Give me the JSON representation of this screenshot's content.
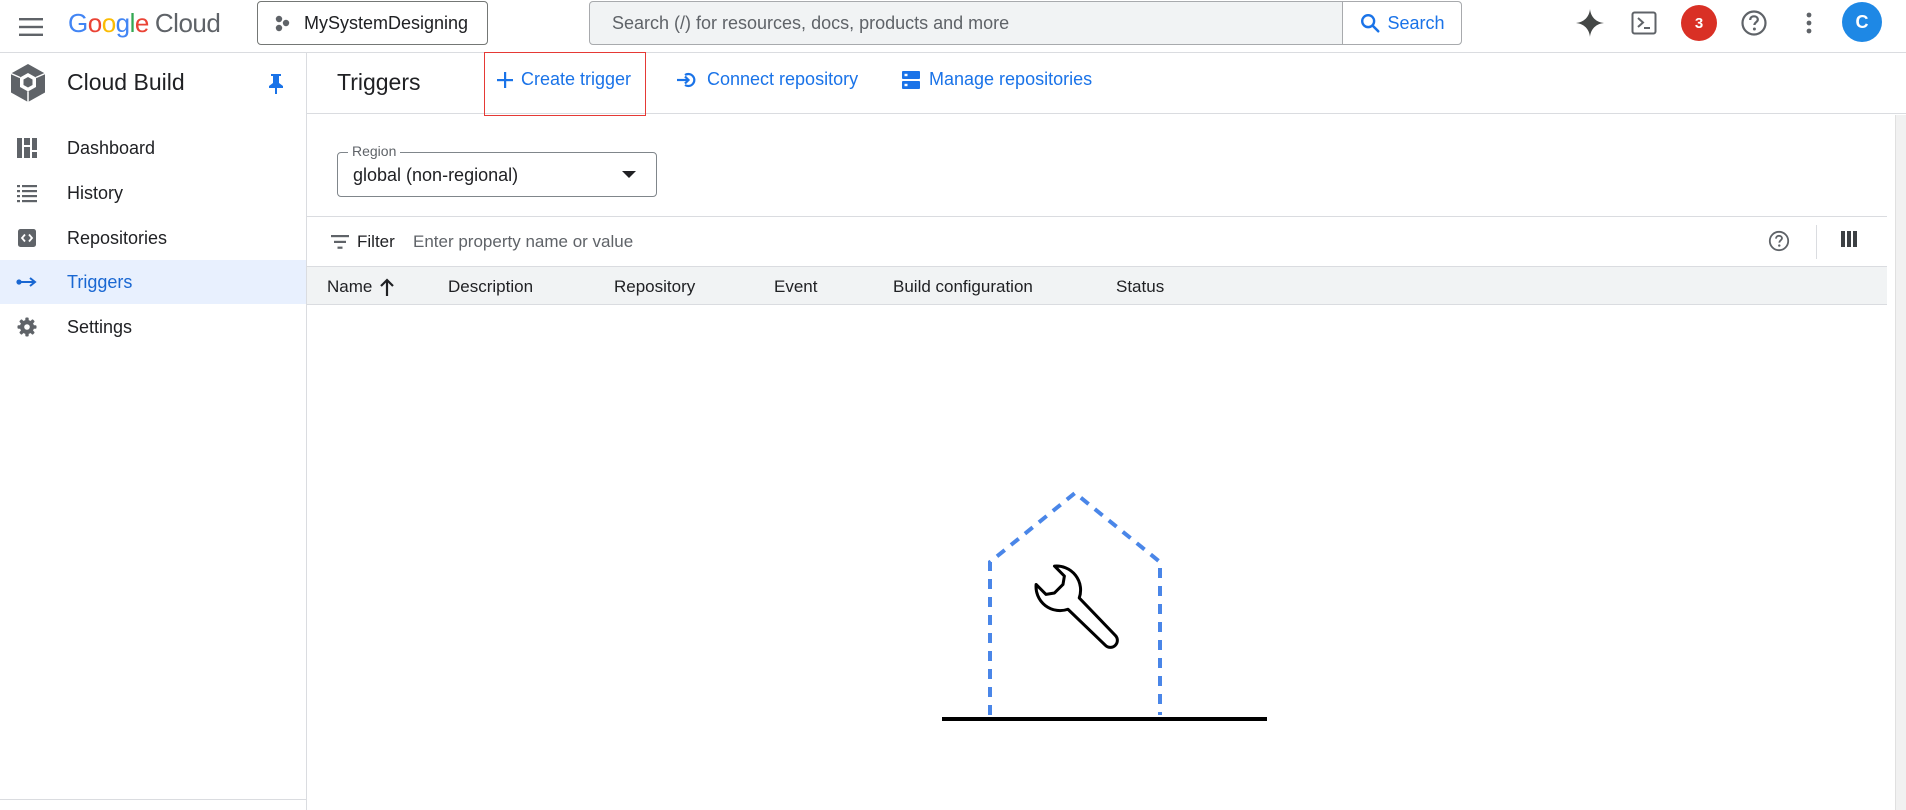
{
  "topbar": {
    "logo": {
      "g1": "G",
      "g2": "o",
      "g3": "o",
      "g4": "g",
      "g5": "l",
      "g6": "e",
      "cloud": "Cloud"
    },
    "project_name": "MySystemDesigning",
    "search_placeholder": "Search (/) for resources, docs, products and more",
    "search_button": "Search",
    "notification_count": "3",
    "avatar_initial": "C",
    "icons": [
      "menu-icon",
      "gemini-sparkle-icon",
      "cloud-shell-icon",
      "help-icon",
      "more-vert-icon"
    ]
  },
  "sidebar": {
    "product_name": "Cloud Build",
    "items": [
      {
        "label": "Dashboard",
        "icon": "dashboard-icon"
      },
      {
        "label": "History",
        "icon": "list-icon"
      },
      {
        "label": "Repositories",
        "icon": "repository-icon"
      },
      {
        "label": "Triggers",
        "icon": "triggers-icon",
        "active": true
      },
      {
        "label": "Settings",
        "icon": "gear-icon"
      }
    ]
  },
  "main": {
    "title": "Triggers",
    "actions": {
      "create": "Create trigger",
      "connect": "Connect repository",
      "manage": "Manage repositories"
    },
    "region": {
      "label": "Region",
      "value": "global (non-regional)"
    },
    "filter": {
      "label": "Filter",
      "placeholder": "Enter property name or value"
    },
    "columns": [
      "Name",
      "Description",
      "Repository",
      "Event",
      "Build configuration",
      "Status"
    ]
  },
  "colors": {
    "accent": "#1a73e8",
    "active_bg": "#e8f0fe",
    "highlight": "#e53935",
    "notification": "#d93025",
    "avatar": "#1e88e5"
  }
}
